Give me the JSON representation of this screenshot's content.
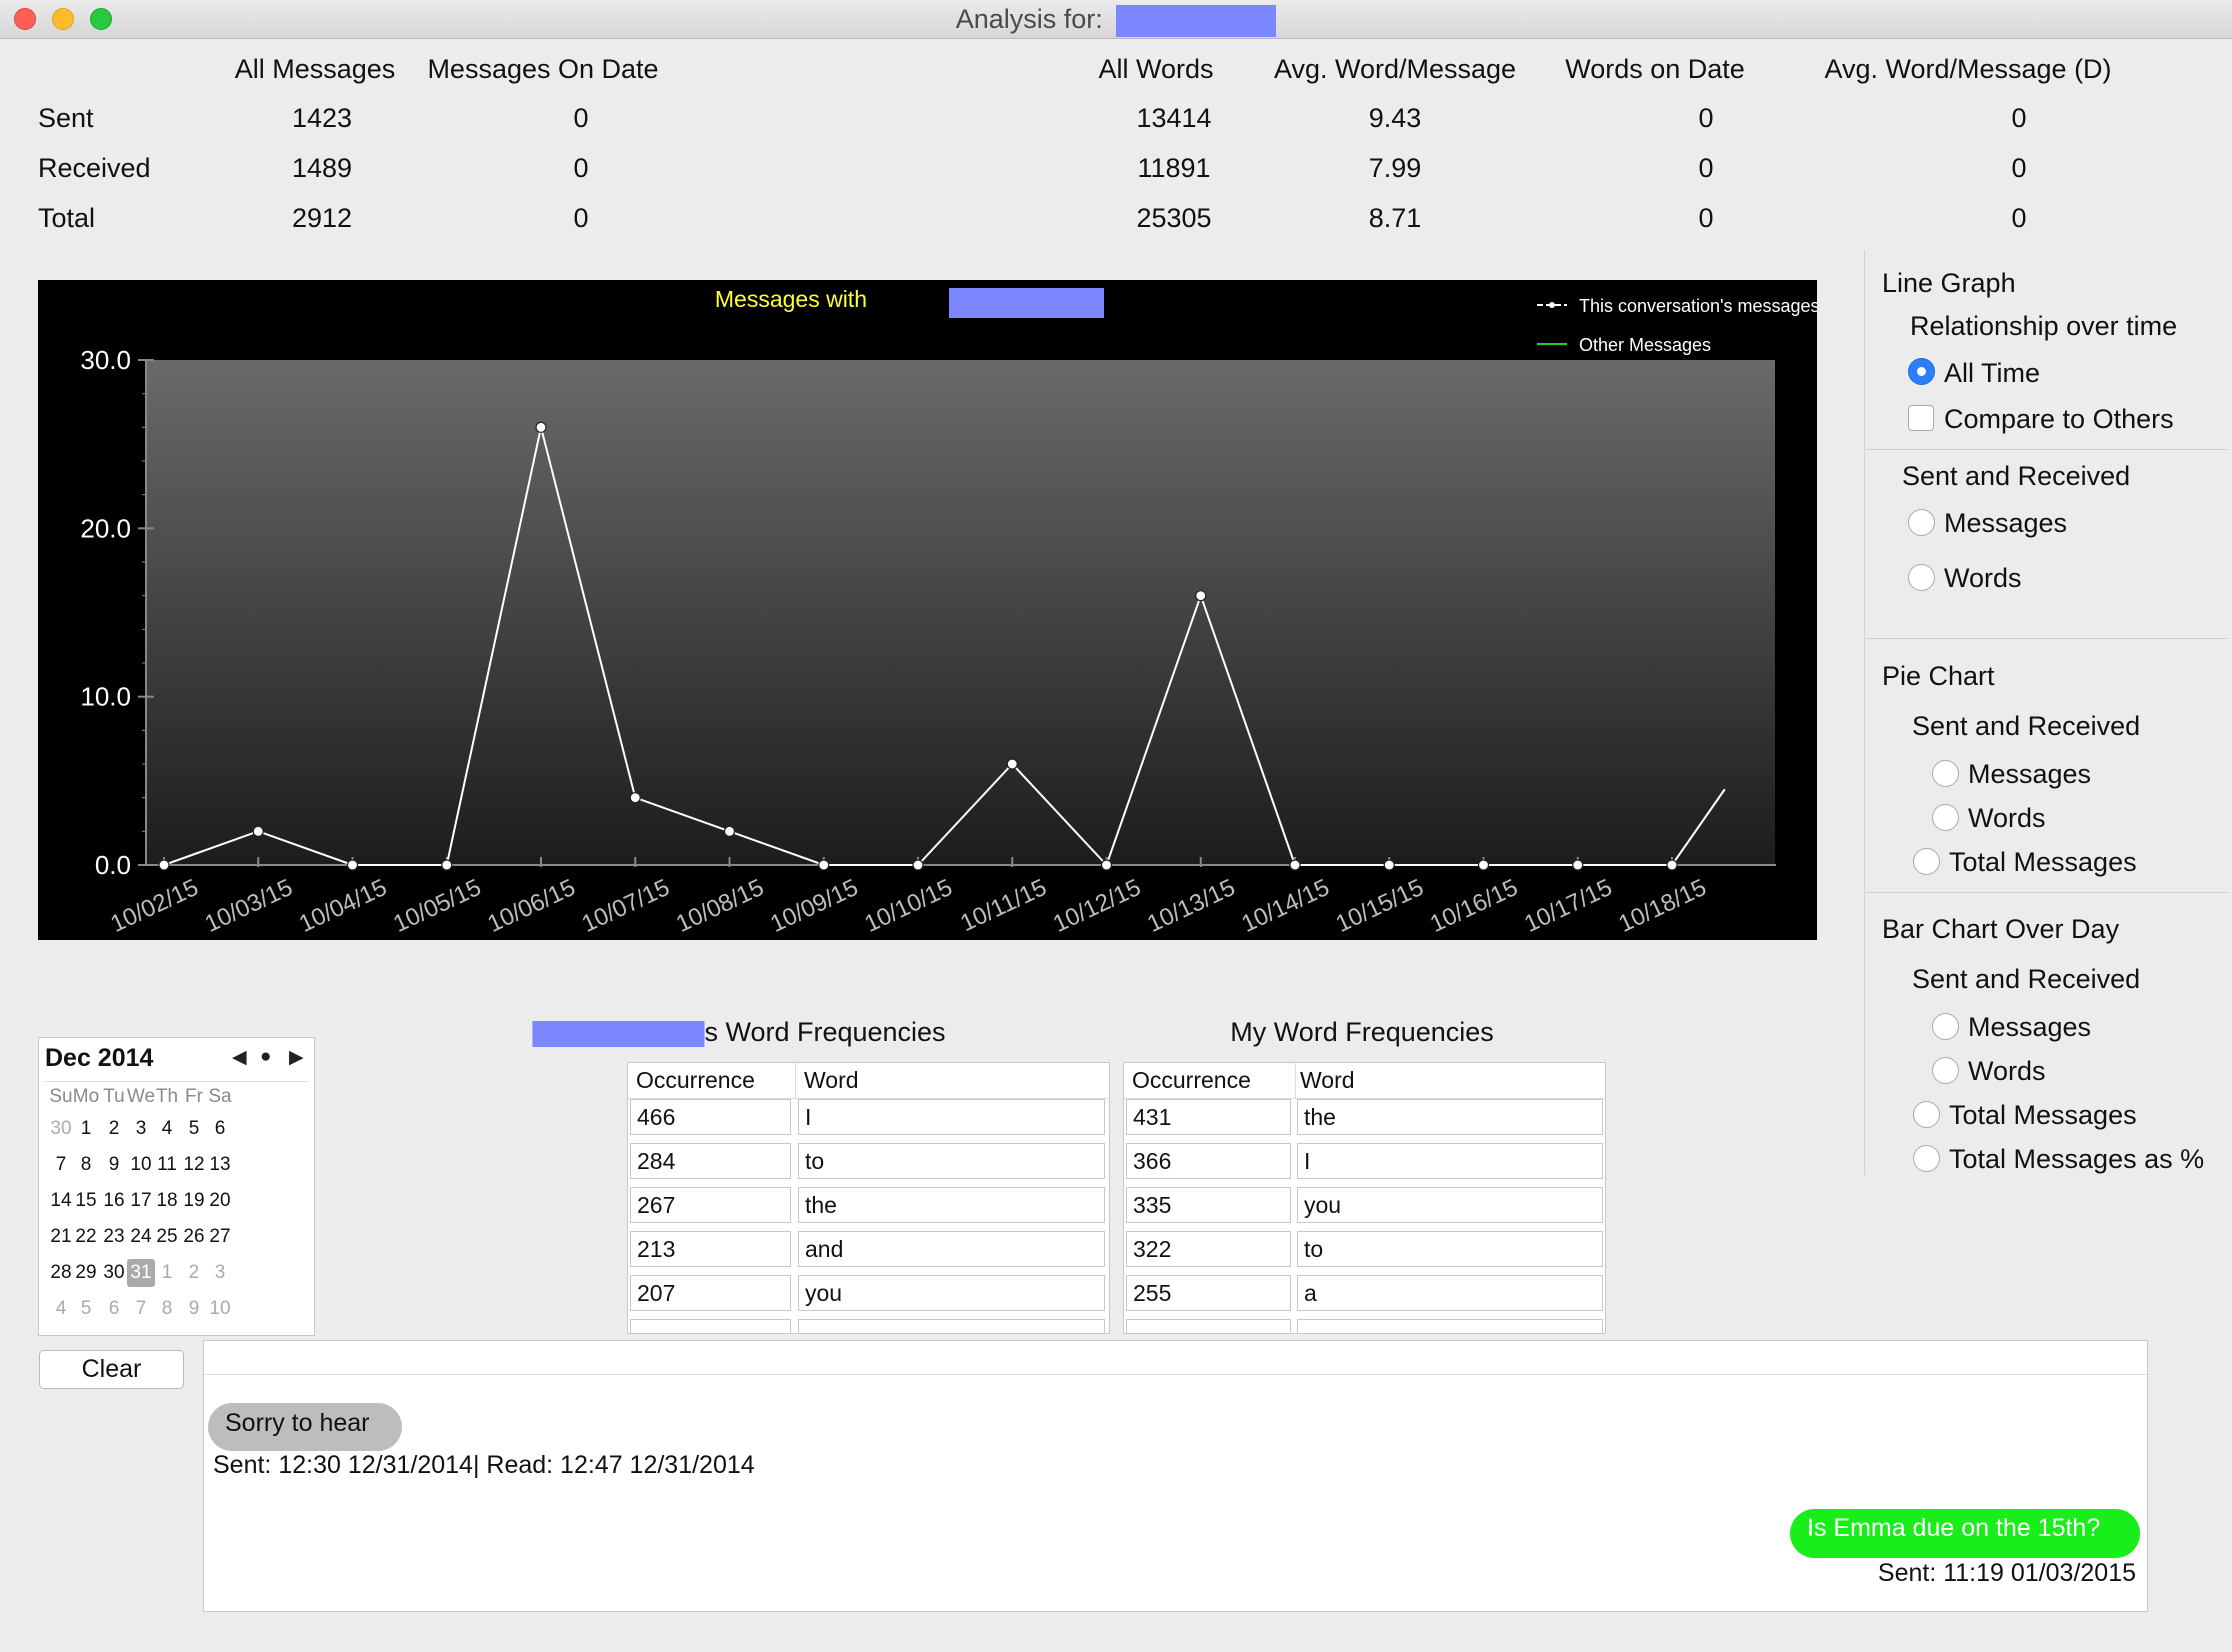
{
  "window": {
    "title": "Analysis for:"
  },
  "stats": {
    "left_headers": [
      "All Messages",
      "Messages On Date"
    ],
    "right_headers": [
      "All Words",
      "Avg. Word/Message",
      "Words on Date",
      "Avg. Word/Message (D)"
    ],
    "rows": [
      {
        "label": "Sent",
        "all_messages": "1423",
        "messages_on_date": "0",
        "all_words": "13414",
        "avg_word_message": "9.43",
        "words_on_date": "0",
        "avg_word_message_d": "0"
      },
      {
        "label": "Received",
        "all_messages": "1489",
        "messages_on_date": "0",
        "all_words": "11891",
        "avg_word_message": "7.99",
        "words_on_date": "0",
        "avg_word_message_d": "0"
      },
      {
        "label": "Total",
        "all_messages": "2912",
        "messages_on_date": "0",
        "all_words": "25305",
        "avg_word_message": "8.71",
        "words_on_date": "0",
        "avg_word_message_d": "0"
      }
    ]
  },
  "chart_data": {
    "type": "line",
    "title": "Messages with",
    "x": [
      "10/02/15",
      "10/03/15",
      "10/04/15",
      "10/05/15",
      "10/06/15",
      "10/07/15",
      "10/08/15",
      "10/09/15",
      "10/10/15",
      "10/11/15",
      "10/12/15",
      "10/13/15",
      "10/14/15",
      "10/15/15",
      "10/16/15",
      "10/17/15",
      "10/18/15"
    ],
    "series": [
      {
        "name": "This conversation's messages",
        "color": "#ffffff",
        "values": [
          0,
          2,
          0,
          0,
          26,
          4,
          2,
          0,
          0,
          6,
          0,
          16,
          0,
          0,
          0,
          0,
          0
        ],
        "continues_to": 4.5
      },
      {
        "name": "Other Messages",
        "color": "#22cc22",
        "values": []
      }
    ],
    "ylim": [
      0,
      30
    ],
    "yticks": [
      "0.0",
      "10.0",
      "20.0",
      "30.0"
    ],
    "legend": "top-right",
    "background": "#000000",
    "title_color": "#ffff33"
  },
  "side_panel": {
    "line_graph": {
      "heading": "Line Graph",
      "sub1": "Relationship over time",
      "all_time": "All Time",
      "compare": "Compare to Others",
      "sub2": "Sent and Received",
      "messages": "Messages",
      "words": "Words"
    },
    "pie_chart": {
      "heading": "Pie Chart",
      "sub": "Sent and Received",
      "messages": "Messages",
      "words": "Words",
      "total": "Total Messages"
    },
    "bar_chart": {
      "heading": "Bar Chart Over Day",
      "sub": "Sent and Received",
      "messages": "Messages",
      "words": "Words",
      "total": "Total Messages",
      "total_pct": "Total Messages as %"
    }
  },
  "calendar": {
    "month_label": "Dec 2014",
    "nav": [
      "◀",
      "●",
      "▶"
    ],
    "weekdays": [
      "Su",
      "Mo",
      "Tu",
      "We",
      "Th",
      "Fr",
      "Sa"
    ],
    "weeks": [
      [
        "30",
        "1",
        "2",
        "3",
        "4",
        "5",
        "6"
      ],
      [
        "7",
        "8",
        "9",
        "10",
        "11",
        "12",
        "13"
      ],
      [
        "14",
        "15",
        "16",
        "17",
        "18",
        "19",
        "20"
      ],
      [
        "21",
        "22",
        "23",
        "24",
        "25",
        "26",
        "27"
      ],
      [
        "28",
        "29",
        "30",
        "31",
        "1",
        "2",
        "3"
      ],
      [
        "4",
        "5",
        "6",
        "7",
        "8",
        "9",
        "10"
      ]
    ],
    "selected": "31"
  },
  "word_freq": {
    "theirs": {
      "title_suffix": "s Word Frequencies",
      "headers": [
        "Occurrence",
        "Word"
      ],
      "rows": [
        [
          "466",
          "I"
        ],
        [
          "284",
          "to"
        ],
        [
          "267",
          "the"
        ],
        [
          "213",
          "and"
        ],
        [
          "207",
          "you"
        ]
      ]
    },
    "mine": {
      "title": "My Word Frequencies",
      "headers": [
        "Occurrence",
        "Word"
      ],
      "rows": [
        [
          "431",
          "the"
        ],
        [
          "366",
          "I"
        ],
        [
          "335",
          "you"
        ],
        [
          "322",
          "to"
        ],
        [
          "255",
          "a"
        ]
      ]
    }
  },
  "clear_button": "Clear",
  "messages": {
    "received": {
      "text": "Sorry to hear",
      "meta": "Sent: 12:30 12/31/2014| Read: 12:47 12/31/2014"
    },
    "sent": {
      "text": "Is Emma due on the 15th?",
      "meta": "Sent: 11:19 01/03/2015"
    }
  }
}
